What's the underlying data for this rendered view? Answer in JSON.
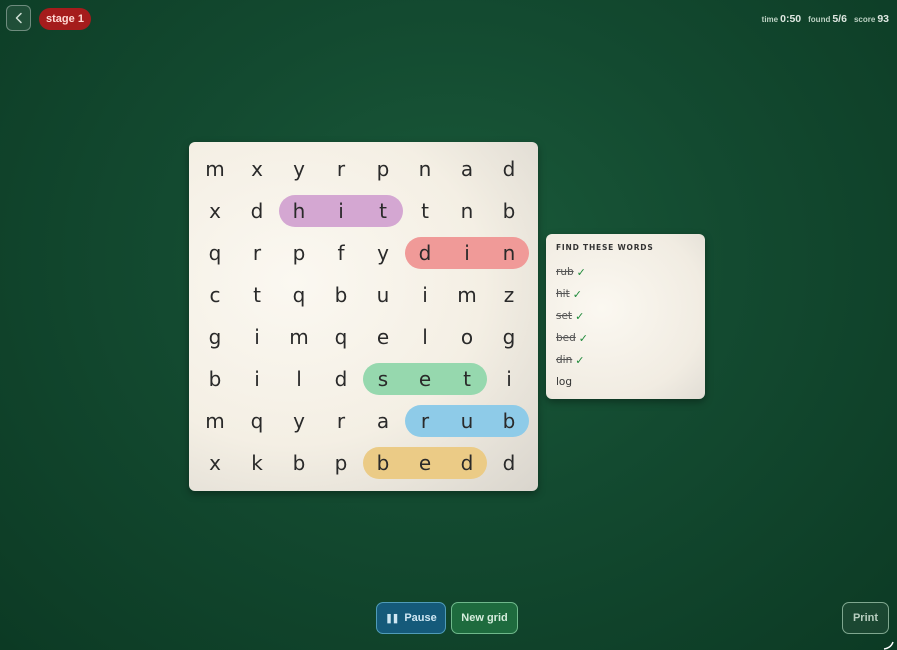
{
  "header": {
    "back_icon": "chevron-left-icon",
    "stage_label": "stage 1",
    "stats": [
      {
        "label": "time",
        "value": "0:50"
      },
      {
        "label": "found",
        "value": "5/6"
      },
      {
        "label": "score",
        "value": "93"
      }
    ]
  },
  "grid": {
    "rows": [
      [
        "m",
        "x",
        "y",
        "r",
        "p",
        "n",
        "a",
        "d"
      ],
      [
        "x",
        "d",
        "h",
        "i",
        "t",
        "t",
        "n",
        "b"
      ],
      [
        "q",
        "r",
        "p",
        "f",
        "y",
        "d",
        "i",
        "n"
      ],
      [
        "c",
        "t",
        "q",
        "b",
        "u",
        "i",
        "m",
        "z"
      ],
      [
        "g",
        "i",
        "m",
        "q",
        "e",
        "l",
        "o",
        "g"
      ],
      [
        "b",
        "i",
        "l",
        "d",
        "s",
        "e",
        "t",
        "i"
      ],
      [
        "m",
        "q",
        "y",
        "r",
        "a",
        "r",
        "u",
        "b"
      ],
      [
        "x",
        "k",
        "b",
        "p",
        "b",
        "e",
        "d",
        "d"
      ]
    ],
    "highlights": [
      {
        "word": "hit",
        "row": 1,
        "col_start": 2,
        "col_end": 4,
        "color": "#d4a7d2"
      },
      {
        "word": "din",
        "row": 2,
        "col_start": 5,
        "col_end": 7,
        "color": "#f09a98"
      },
      {
        "word": "set",
        "row": 5,
        "col_start": 4,
        "col_end": 6,
        "color": "#96d8ae"
      },
      {
        "word": "rub",
        "row": 6,
        "col_start": 5,
        "col_end": 7,
        "color": "#8ecbe8"
      },
      {
        "word": "bed",
        "row": 7,
        "col_start": 4,
        "col_end": 6,
        "color": "#ebcb86"
      }
    ]
  },
  "word_list": {
    "title": "FIND THESE WORDS",
    "check_mark": "✓",
    "items": [
      {
        "word": "rub",
        "found": true
      },
      {
        "word": "hit",
        "found": true
      },
      {
        "word": "set",
        "found": true
      },
      {
        "word": "bed",
        "found": true
      },
      {
        "word": "din",
        "found": true
      },
      {
        "word": "log",
        "found": false
      }
    ]
  },
  "controls": {
    "pause_icon": "pause-icon",
    "pause_label": "Pause",
    "new_grid_label": "New grid",
    "print_label": "Print"
  }
}
